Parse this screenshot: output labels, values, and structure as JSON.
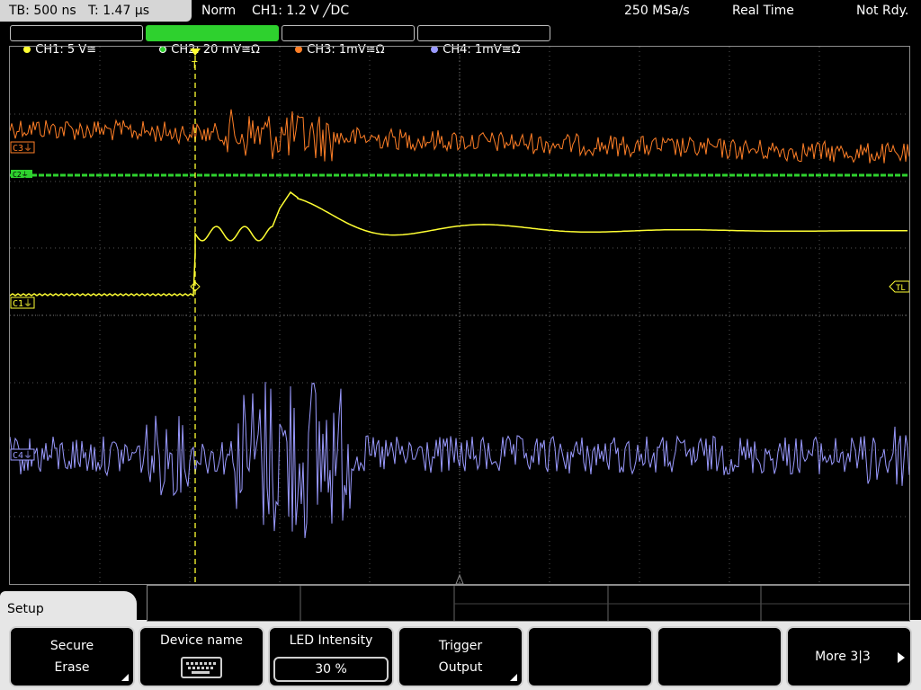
{
  "status_bar": {
    "timebase": "TB: 500 ns   T: 1.47 µs",
    "acq_mode": "Norm",
    "trigger_info": "CH1: 1.2 V ╱DC",
    "sample_rate": "250 MSa/s",
    "mode": "Real Time",
    "trigger_status": "Not Rdy."
  },
  "channels": [
    {
      "label": "CH1: 5 V≅",
      "color": "#ffff33",
      "active": false
    },
    {
      "label": "CH2: 20 mV≅Ω",
      "color": "#2ed12e",
      "active": true
    },
    {
      "label": "CH3: 1mV≅Ω",
      "color": "#ff7f27",
      "active": false
    },
    {
      "label": "CH4: 1mV≅Ω",
      "color": "#9a9aff",
      "active": false
    }
  ],
  "markers": {
    "c3": "C3⏚",
    "c2": "C2⏚",
    "c1": "C1⏚",
    "c4": "C4⏚",
    "trigger_level": "TL",
    "trigger_pos": "T"
  },
  "menu": {
    "title": "Setup",
    "softkeys": [
      {
        "line1": "Secure",
        "line2": "Erase",
        "has_submenu": true
      },
      {
        "line1": "Device name",
        "icon": "keyboard-icon"
      },
      {
        "line1": "LED Intensity",
        "value": "30 %"
      },
      {
        "line1": "Trigger",
        "line2": "Output",
        "has_submenu": true
      },
      {
        "line1": ""
      },
      {
        "line1": ""
      },
      {
        "line1": "More 3|3",
        "has_arrow": true
      }
    ]
  },
  "colors": {
    "ch1": "#ffff33",
    "ch2": "#2ed12e",
    "ch3": "#ff7f27",
    "ch4": "#9a9aff",
    "grid": "#6e6e6e"
  }
}
